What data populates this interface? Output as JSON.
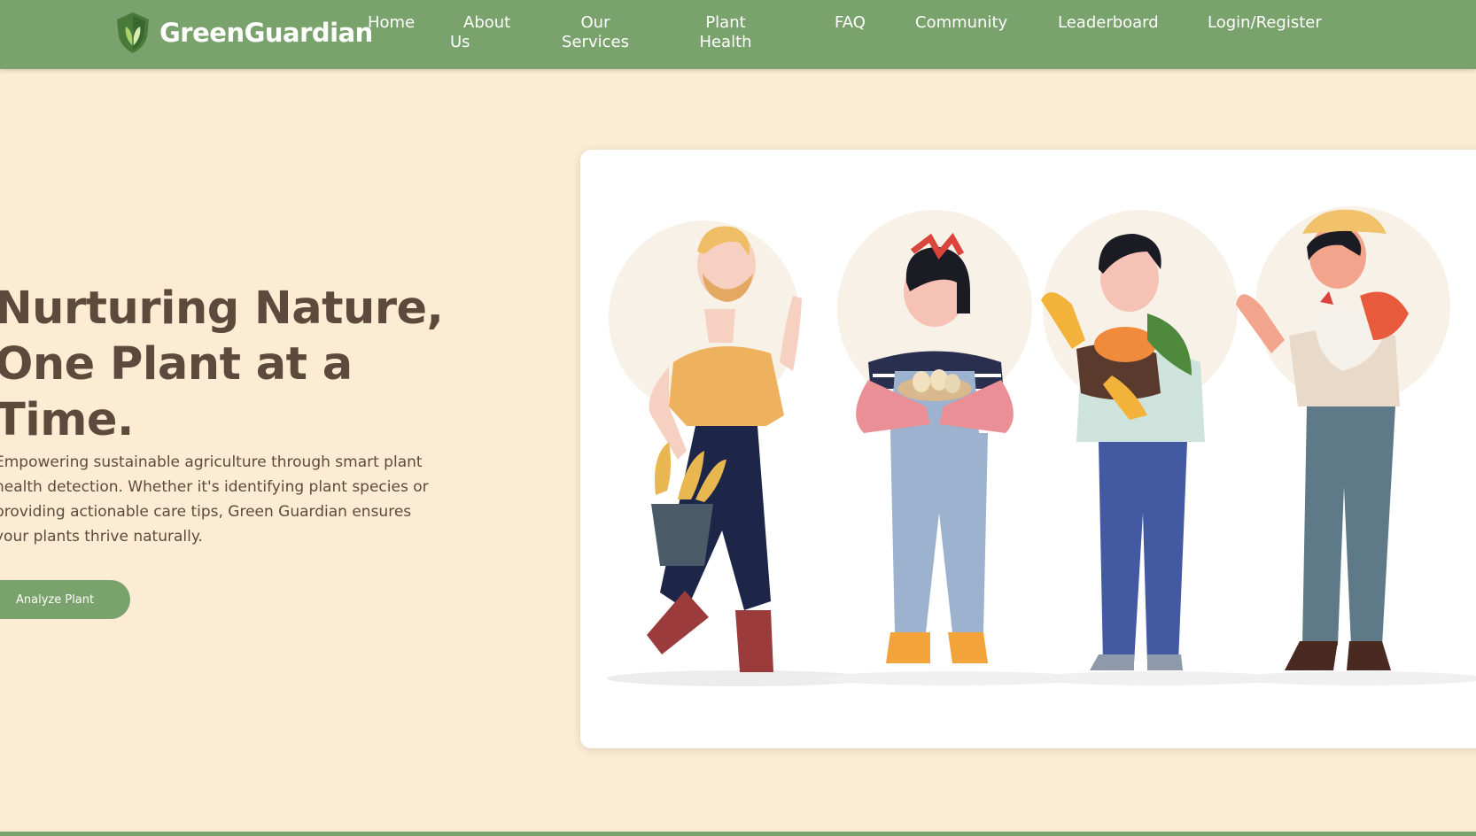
{
  "header": {
    "brand": "GreenGuardian",
    "logo_icon": "leaf-shield-icon",
    "nav": [
      {
        "label": "Home"
      },
      {
        "label": "About Us"
      },
      {
        "label": "Our Services"
      },
      {
        "label": "Plant Health"
      },
      {
        "label": "FAQ"
      },
      {
        "label": "Community"
      },
      {
        "label": "Leaderboard"
      },
      {
        "label": "Login/Register"
      }
    ]
  },
  "hero": {
    "title": "Nurturing Nature, One Plant at a Time.",
    "description": "Empowering sustainable agriculture through smart plant health detection. Whether it's identifying plant species or providing actionable care tips, Green Guardian ensures your plants thrive naturally.",
    "cta_label": "Analyze Plant"
  },
  "colors": {
    "primary_green": "#7aa26c",
    "background": "#fcecd4",
    "heading_brown": "#5e4a3c"
  }
}
